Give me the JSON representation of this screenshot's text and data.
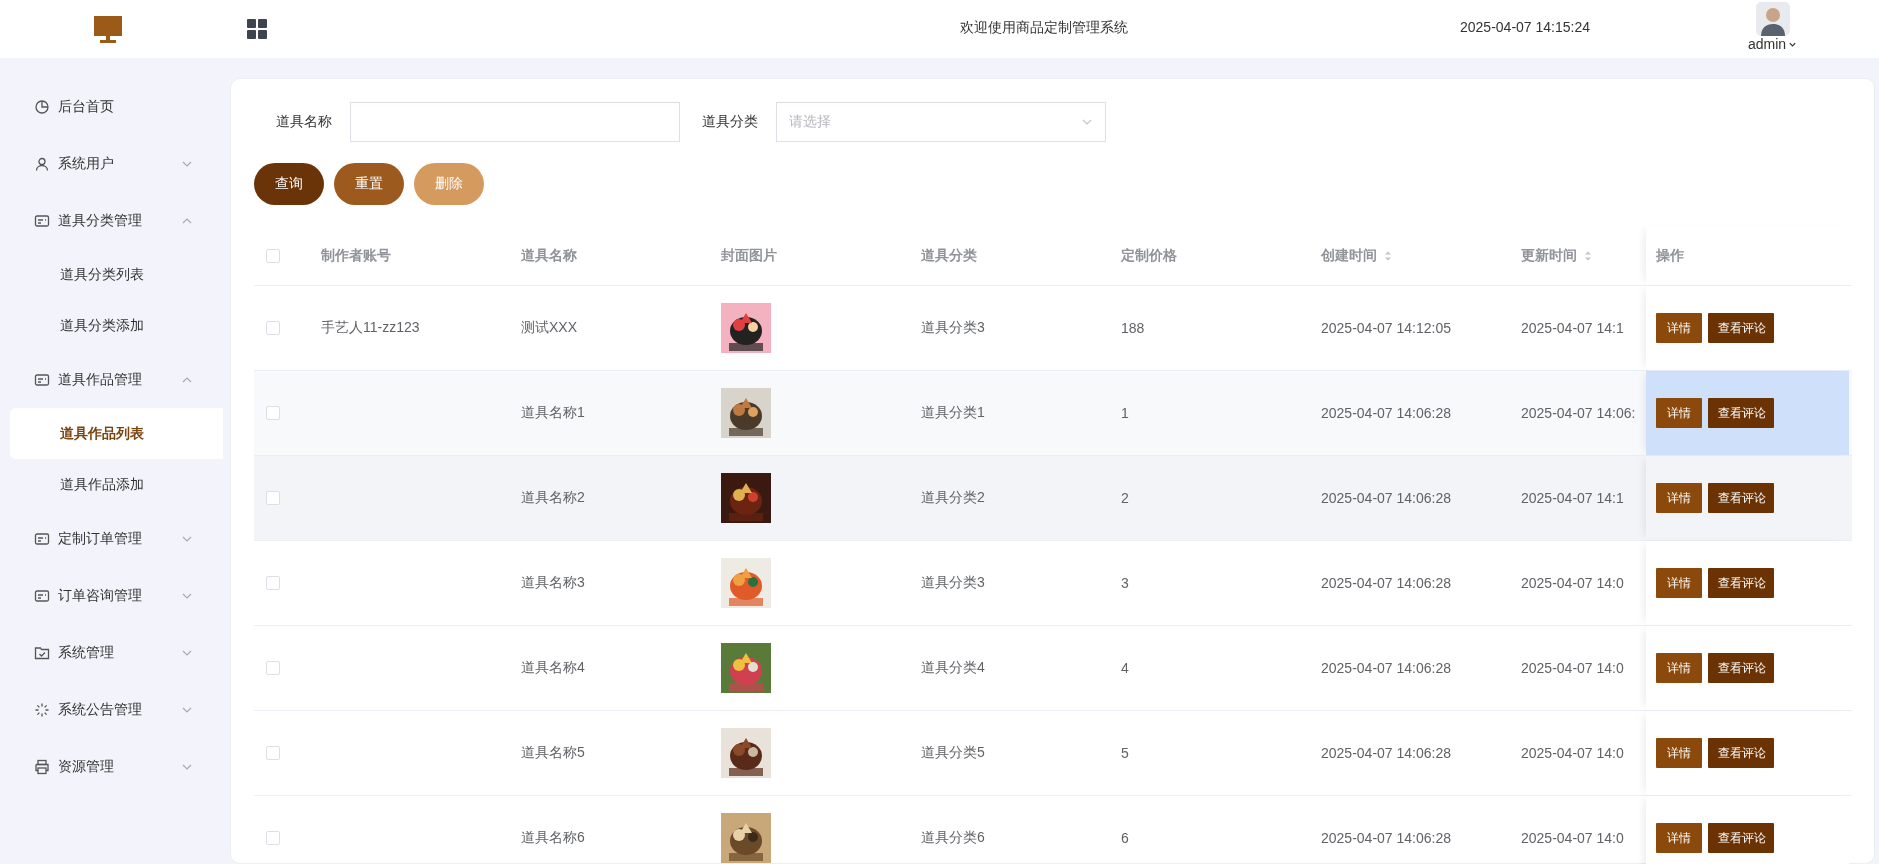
{
  "header": {
    "title": "欢迎使用商品定制管理系统",
    "datetime": "2025-04-07 14:15:24",
    "user": "admin"
  },
  "sidebar": {
    "items": [
      {
        "label": "后台首页"
      },
      {
        "label": "系统用户",
        "expanded": false
      },
      {
        "label": "道具分类管理",
        "expanded": true,
        "children": [
          {
            "label": "道具分类列表",
            "selected": false
          },
          {
            "label": "道具分类添加",
            "selected": false
          }
        ]
      },
      {
        "label": "道具作品管理",
        "expanded": true,
        "children": [
          {
            "label": "道具作品列表",
            "selected": true
          },
          {
            "label": "道具作品添加",
            "selected": false
          }
        ]
      },
      {
        "label": "定制订单管理",
        "expanded": false
      },
      {
        "label": "订单咨询管理",
        "expanded": false
      },
      {
        "label": "系统管理",
        "expanded": false
      },
      {
        "label": "系统公告管理",
        "expanded": false
      },
      {
        "label": "资源管理",
        "expanded": false
      }
    ]
  },
  "filters": [
    {
      "label": "道具名称",
      "kind": "text"
    },
    {
      "label": "道具分类",
      "kind": "select",
      "placeholder": "请选择"
    }
  ],
  "buttons": [
    {
      "label": "查询",
      "disabled": false
    },
    {
      "label": "重置",
      "disabled": false
    },
    {
      "label": "删除",
      "disabled": true
    }
  ],
  "table": {
    "select_all_checked": false,
    "columns": [
      {
        "label": "制作者账号",
        "sortable": false
      },
      {
        "label": "道具名称",
        "sortable": false
      },
      {
        "label": "封面图片",
        "sortable": false
      },
      {
        "label": "道具分类",
        "sortable": false
      },
      {
        "label": "定制价格",
        "sortable": false
      },
      {
        "label": "创建时间",
        "sortable": true
      },
      {
        "label": "更新时间",
        "sortable": true
      },
      {
        "label": "操作",
        "sortable": false
      }
    ],
    "rows": [
      {
        "account": "手艺人11-zz123",
        "name": "测试XXX",
        "category": "道具分类3",
        "price": "188",
        "created": "2025-04-07 14:12:05",
        "updated": "2025-04-07 14:1",
        "checked": false,
        "hovered": false,
        "shaded": false,
        "actions": [
          "详情",
          "查看评论"
        ]
      },
      {
        "name": "道具名称1",
        "category": "道具分类1",
        "price": "1",
        "created": "2025-04-07 14:06:28",
        "updated": "2025-04-07 14:06:",
        "checked": false,
        "hovered": true,
        "shaded": false,
        "actions": [
          "详情",
          "查看评论"
        ]
      },
      {
        "name": "道具名称2",
        "category": "道具分类2",
        "price": "2",
        "created": "2025-04-07 14:06:28",
        "updated": "2025-04-07 14:1",
        "checked": false,
        "hovered": false,
        "shaded": true,
        "actions": [
          "详情",
          "查看评论"
        ]
      },
      {
        "name": "道具名称3",
        "category": "道具分类3",
        "price": "3",
        "created": "2025-04-07 14:06:28",
        "updated": "2025-04-07 14:0",
        "checked": false,
        "hovered": false,
        "shaded": false,
        "actions": [
          "详情",
          "查看评论"
        ]
      },
      {
        "name": "道具名称4",
        "category": "道具分类4",
        "price": "4",
        "created": "2025-04-07 14:06:28",
        "updated": "2025-04-07 14:0",
        "checked": false,
        "hovered": false,
        "shaded": false,
        "actions": [
          "详情",
          "查看评论"
        ]
      },
      {
        "name": "道具名称5",
        "category": "道具分类5",
        "price": "5",
        "created": "2025-04-07 14:06:28",
        "updated": "2025-04-07 14:0",
        "checked": false,
        "hovered": false,
        "shaded": false,
        "actions": [
          "详情",
          "查看评论"
        ]
      },
      {
        "name": "道具名称6",
        "category": "道具分类6",
        "price": "6",
        "created": "2025-04-07 14:06:28",
        "updated": "2025-04-07 14:0",
        "checked": false,
        "hovered": false,
        "shaded": false,
        "actions": [
          "详情",
          "查看评论"
        ]
      }
    ]
  }
}
